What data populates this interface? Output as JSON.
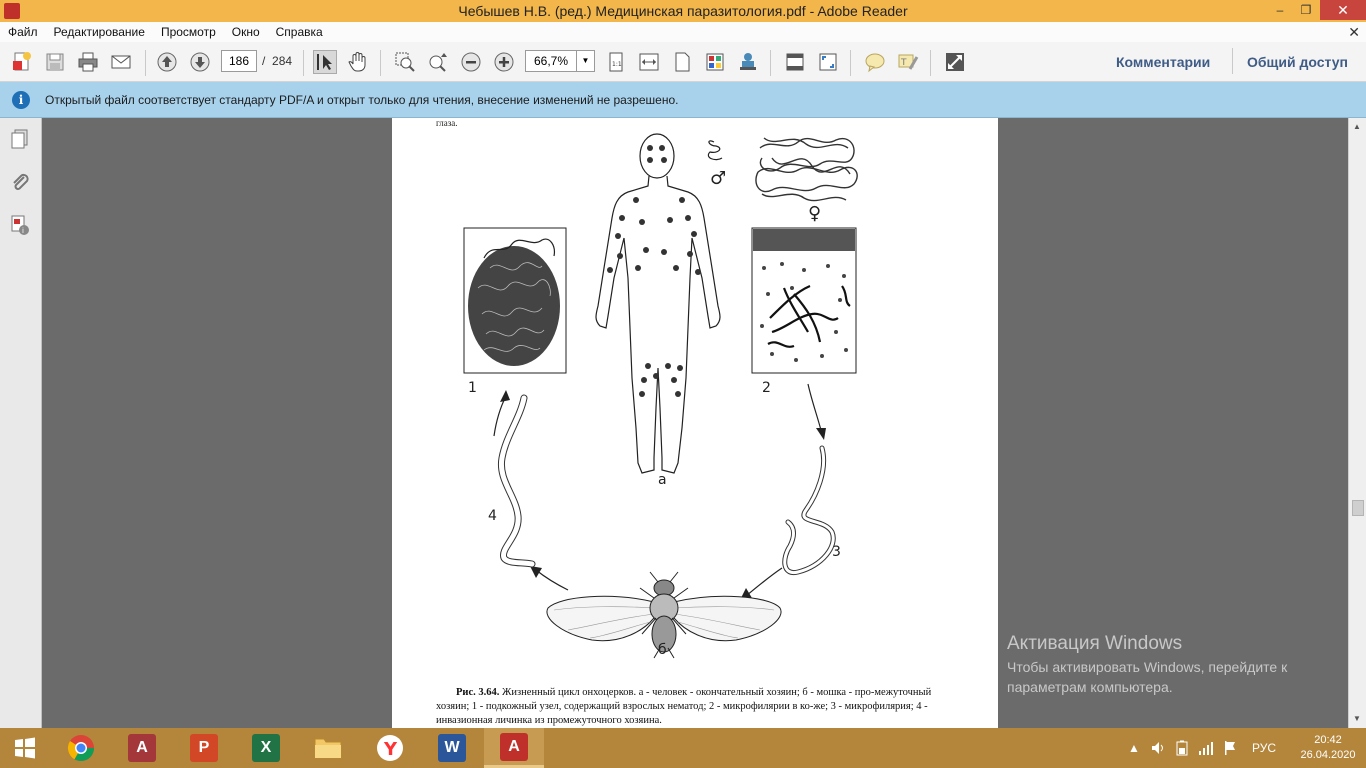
{
  "window": {
    "title": "Чебышев Н.В. (ред.) Медицинская паразитология.pdf - Adobe Reader",
    "minimize": "‒",
    "maximize": "❐",
    "close": "✕"
  },
  "menu": {
    "items": [
      "Файл",
      "Редактирование",
      "Просмотр",
      "Окно",
      "Справка"
    ],
    "close": "✕"
  },
  "toolbar": {
    "current_page": "186",
    "page_separator": "/",
    "total_pages": "284",
    "zoom": "66,7%",
    "comments_label": "Комментарии",
    "share_label": "Общий доступ"
  },
  "infobar": {
    "icon": "i",
    "message": "Открытый файл соответствует стандарту PDF/A и открыт только для чтения, внесение изменений не разрешено."
  },
  "document": {
    "top_text": "глаза.",
    "figure_labels": {
      "a": "а",
      "b": "б",
      "n1": "1",
      "n2": "2",
      "n3": "3",
      "n4": "4",
      "male": "♂",
      "female": "♀"
    },
    "caption_bold": "Рис. 3.64.",
    "caption_text": " Жизненный цикл онхоцерков. а - человек - окончательный хозяин; б - мошка - про-межуточный хозяин; 1 - подкожный узел, содержащий взрослых нематод; 2 - микрофилярии в ко-же; 3 - микрофилярия; 4 - инвазионная личинка из промежуточного хозяина."
  },
  "watermark": {
    "title": "Активация Windows",
    "subtitle": "Чтобы активировать Windows, перейдите к параметрам компьютера."
  },
  "taskbar": {
    "language": "РУС",
    "time": "20:42",
    "date": "26.04.2020"
  }
}
